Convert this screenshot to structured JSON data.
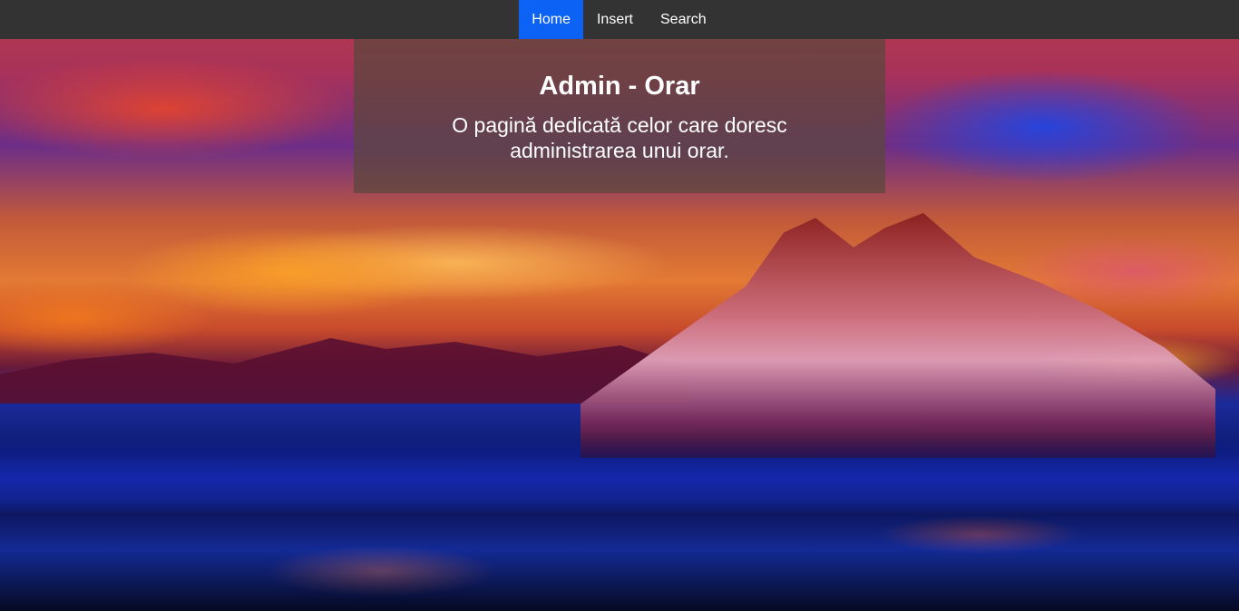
{
  "nav": {
    "items": [
      {
        "label": "Home",
        "active": true
      },
      {
        "label": "Insert",
        "active": false
      },
      {
        "label": "Search",
        "active": false
      }
    ]
  },
  "hero": {
    "title": "Admin - Orar",
    "subtitle": "O pagină dedicată celor care doresc administrarea unui orar."
  },
  "background": {
    "description_icon": "mountain-sunset-painting"
  },
  "colors": {
    "navbar": "#333333",
    "nav_active": "#0b62f5",
    "text": "#ffffff",
    "hero_overlay": "rgba(90,70,60,0.72)"
  }
}
